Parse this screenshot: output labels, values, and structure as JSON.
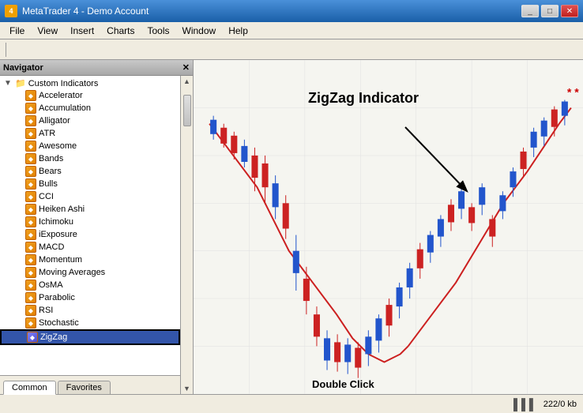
{
  "titleBar": {
    "title": "MetaTrader 4 - Demo Account",
    "icon": "MT4",
    "controls": [
      "minimize",
      "maximize",
      "close"
    ]
  },
  "menuBar": {
    "items": [
      "File",
      "View",
      "Insert",
      "Charts",
      "Tools",
      "Window",
      "Help"
    ]
  },
  "navigator": {
    "title": "Navigator",
    "sections": [
      {
        "label": "Custom Indicators",
        "expanded": true,
        "items": [
          "Accelerator",
          "Accumulation",
          "Alligator",
          "ATR",
          "Awesome",
          "Bands",
          "Bears",
          "Bulls",
          "CCI",
          "Heiken Ashi",
          "Ichimoku",
          "iExposure",
          "MACD",
          "Momentum",
          "Moving Averages",
          "OsMA",
          "Parabolic",
          "RSI",
          "Stochastic",
          "ZigZag"
        ]
      }
    ],
    "selectedItem": "ZigZag"
  },
  "tabs": {
    "common": "Common",
    "favorites": "Favorites"
  },
  "activeTab": "Common",
  "chart": {
    "annotation": "ZigZag Indicator",
    "doubleClickLabel": "Double Click"
  },
  "statusBar": {
    "memory": "222/0 kb"
  }
}
